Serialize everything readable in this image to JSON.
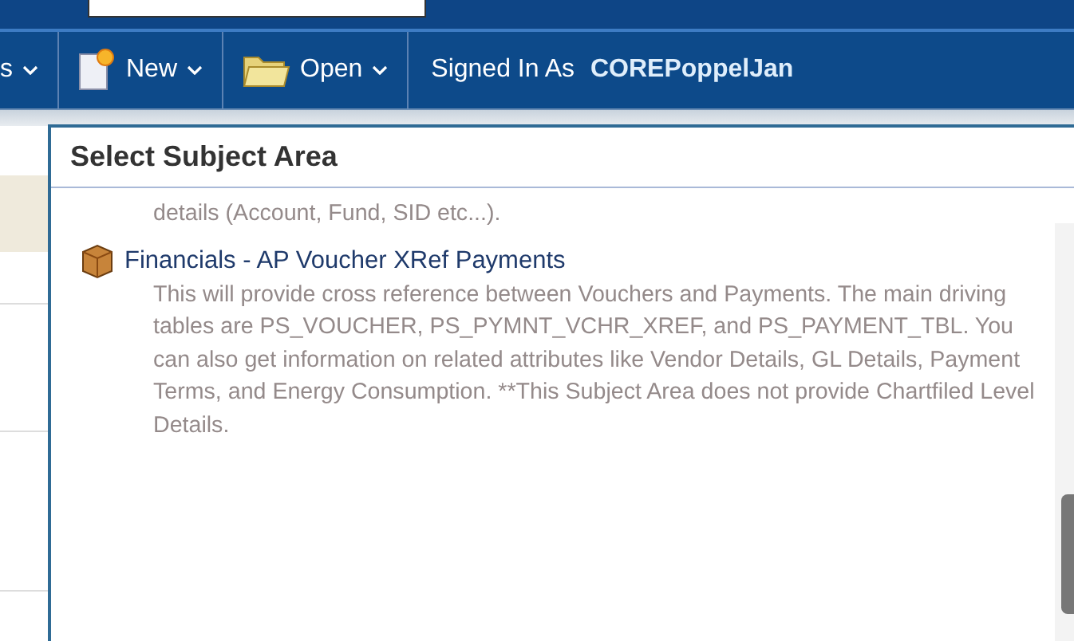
{
  "toolbar": {
    "items": [
      {
        "label": "s",
        "kind": "menu"
      },
      {
        "label": "New",
        "kind": "new"
      },
      {
        "label": "Open",
        "kind": "open"
      }
    ],
    "signed_in_label": "Signed In As",
    "user": "COREPoppelJan"
  },
  "dialog": {
    "title": "Select Subject Area",
    "previous_description": "details (Account, Fund, SID etc...).",
    "items": [
      {
        "name": "Financials - AP Voucher XRef Payments",
        "description": "This will provide cross reference between Vouchers and Payments. The main driving tables are PS_VOUCHER, PS_PYMNT_VCHR_XREF, and PS_PAYMENT_TBL. You can also get information on related attributes like Vendor Details, GL Details, Payment Terms, and Energy Consumption. **This Subject Area does not provide Chartfiled Level Details."
      }
    ]
  }
}
